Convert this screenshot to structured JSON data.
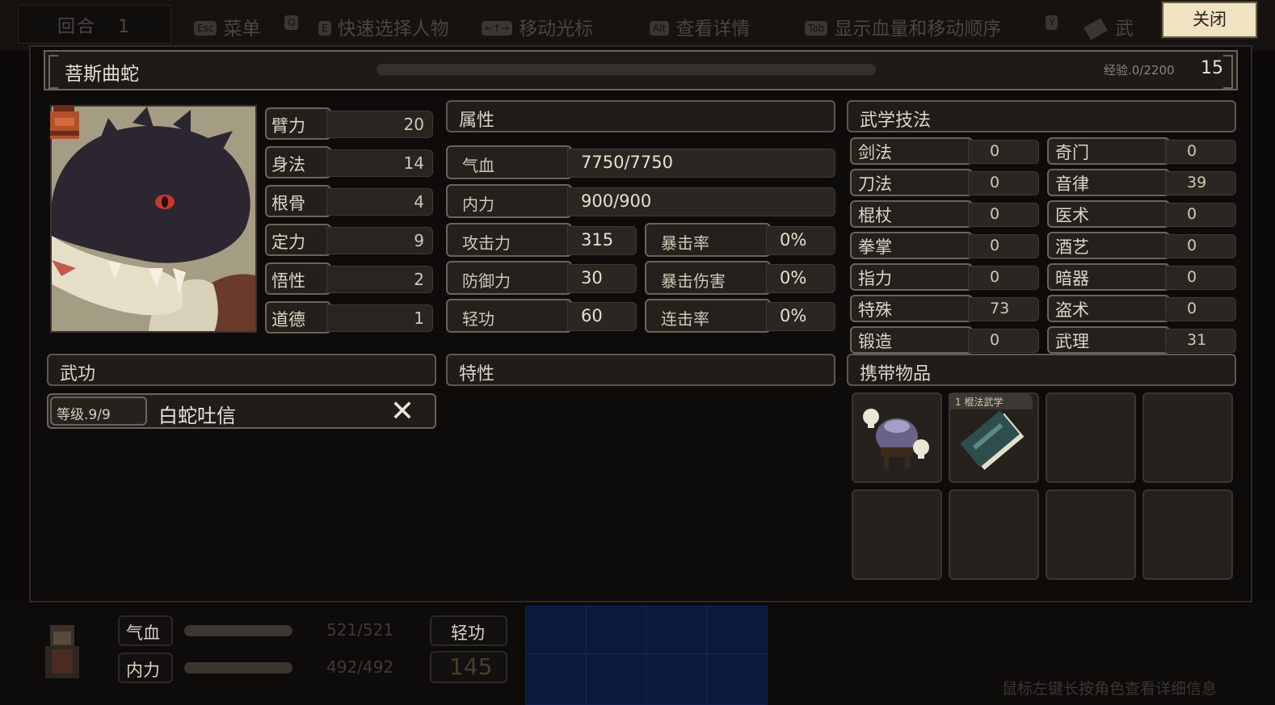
{
  "top_hud": {
    "round_label": "回合",
    "round_value": "1",
    "hints": [
      {
        "key": "Esc",
        "label": "菜单"
      },
      {
        "key": "Q",
        "label": ""
      },
      {
        "key": "E",
        "label": "快速选择人物"
      },
      {
        "key": "←↑→",
        "label": "移动光标"
      },
      {
        "key": "Alt",
        "label": "查看详情"
      },
      {
        "key": "Tab",
        "label": "显示血量和移动顺序"
      },
      {
        "key": "Y",
        "label": ""
      },
      {
        "key": "",
        "label": "武"
      }
    ],
    "close_label": "关闭"
  },
  "character": {
    "name": "菩斯曲蛇",
    "exp_text": "经验.0/2200",
    "level": "15"
  },
  "base_stats": [
    {
      "label": "臂力",
      "value": "20"
    },
    {
      "label": "身法",
      "value": "14"
    },
    {
      "label": "根骨",
      "value": "4"
    },
    {
      "label": "定力",
      "value": "9"
    },
    {
      "label": "悟性",
      "value": "2"
    },
    {
      "label": "道德",
      "value": "1"
    }
  ],
  "attributes": {
    "title": "属性",
    "hp": {
      "label": "气血",
      "value": "7750/7750"
    },
    "mp": {
      "label": "内力",
      "value": "900/900"
    },
    "atk": {
      "label": "攻击力",
      "value": "315"
    },
    "crit_rate": {
      "label": "暴击率",
      "value": "0%"
    },
    "def": {
      "label": "防御力",
      "value": "30"
    },
    "crit_dmg": {
      "label": "暴击伤害",
      "value": "0%"
    },
    "qinggong": {
      "label": "轻功",
      "value": "60"
    },
    "combo": {
      "label": "连击率",
      "value": "0%"
    }
  },
  "skills": {
    "title": "武学技法",
    "left": [
      {
        "label": "剑法",
        "value": "0"
      },
      {
        "label": "刀法",
        "value": "0"
      },
      {
        "label": "棍杖",
        "value": "0"
      },
      {
        "label": "拳掌",
        "value": "0"
      },
      {
        "label": "指力",
        "value": "0"
      },
      {
        "label": "特殊",
        "value": "73"
      },
      {
        "label": "锻造",
        "value": "0"
      }
    ],
    "right": [
      {
        "label": "奇门",
        "value": "0"
      },
      {
        "label": "音律",
        "value": "39"
      },
      {
        "label": "医术",
        "value": "0"
      },
      {
        "label": "酒艺",
        "value": "0"
      },
      {
        "label": "暗器",
        "value": "0"
      },
      {
        "label": "盗术",
        "value": "0"
      },
      {
        "label": "武理",
        "value": "31"
      }
    ]
  },
  "martial_arts": {
    "title": "武功",
    "items": [
      {
        "level": "等级.9/9",
        "name": "白蛇吐信"
      }
    ]
  },
  "traits": {
    "title": "特性"
  },
  "inventory": {
    "title": "携带物品",
    "items": [
      {
        "icon": "poison-cauldron-icon"
      },
      {
        "icon": "staff-manual-book-icon",
        "tag": "1 棍法武学"
      }
    ]
  },
  "bottom_hud": {
    "hp_label": "气血",
    "hp_value": "521/521",
    "mp_label": "内力",
    "mp_value": "492/492",
    "qinggong_label": "轻功",
    "qinggong_value": "145",
    "hint": "鼠标左键长按角色查看详细信息"
  },
  "colors": {
    "background": "#0b0a09",
    "panel": "#1e1b18",
    "border": "#6a645a",
    "text": "#ddd6c4",
    "close_button": "#efe3c2",
    "portrait_eye": "#c8382c"
  }
}
